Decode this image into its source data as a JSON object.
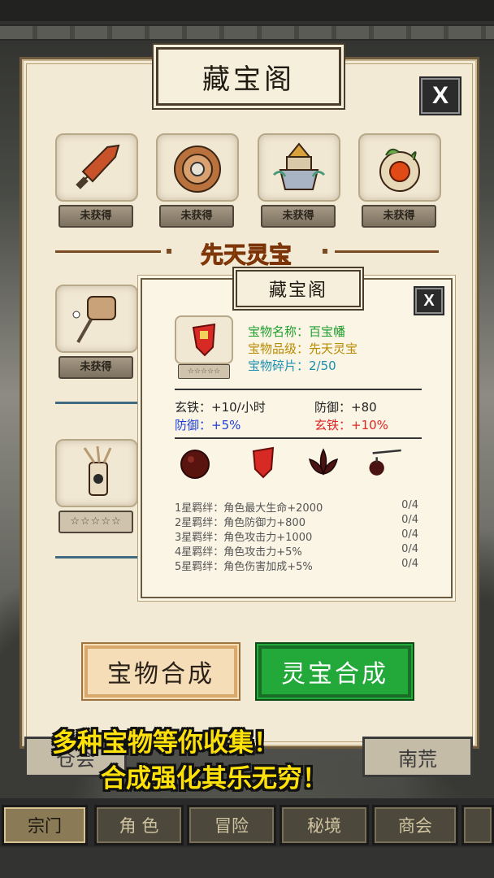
{
  "panel": {
    "title": "藏宝阁",
    "close_label": "X"
  },
  "treasures_row1": [
    {
      "icon": "sword-icon",
      "status": "未获得"
    },
    {
      "icon": "disc-icon",
      "status": "未获得"
    },
    {
      "icon": "tower-icon",
      "status": "未获得"
    },
    {
      "icon": "orb-icon",
      "status": "未获得"
    }
  ],
  "section": {
    "title": "先天灵宝"
  },
  "treasures_left": [
    {
      "icon": "banner-staff-icon",
      "status": "未获得"
    },
    {
      "icon": "quiver-icon",
      "status": "☆☆☆☆☆"
    }
  ],
  "detail": {
    "title": "藏宝阁",
    "close_label": "X",
    "stars": "☆☆☆☆☆",
    "name_line": "宝物名称：百宝幡",
    "grade_line": "宝物品级：先天灵宝",
    "shard_line": "宝物碎片：2/50",
    "stats": [
      {
        "text": "玄铁：+10/小时",
        "color": "#222222"
      },
      {
        "text": "防御：+80",
        "color": "#222222"
      },
      {
        "text": "防御：+5%",
        "color": "#1f3fd6"
      },
      {
        "text": "玄铁：+10%",
        "color": "#e02424"
      }
    ],
    "bond_icons": [
      "red-bead-icon",
      "banner-icon",
      "lotus-icon",
      "whip-icon"
    ],
    "bonds": [
      {
        "label": "1星羁绊：角色最大生命+2000",
        "progress": "0/4"
      },
      {
        "label": "2星羁绊：角色防御力+800",
        "progress": "0/4"
      },
      {
        "label": "3星羁绊：角色攻击力+1000",
        "progress": "0/4"
      },
      {
        "label": "4星羁绊：角色攻击力+5%",
        "progress": "0/4"
      },
      {
        "label": "5星羁绊：角色伤害加成+5%",
        "progress": "0/4"
      }
    ]
  },
  "buttons": {
    "treasure_merge": "宝物合成",
    "spirit_merge": "灵宝合成"
  },
  "sub_tabs": {
    "left": "仓会",
    "right": "南荒"
  },
  "promo": {
    "line1": "多种宝物等你收集！",
    "line2": "合成强化其乐无穷！"
  },
  "nav": [
    "宗门",
    "角 色",
    "冒险",
    "秘境",
    "商会"
  ],
  "colors": {
    "accent_orange": "#e86a12",
    "merge_green": "#23a83a",
    "name_green": "#1f9e2c",
    "grade_gold": "#b88a00",
    "shard_teal": "#1a8fb0"
  }
}
